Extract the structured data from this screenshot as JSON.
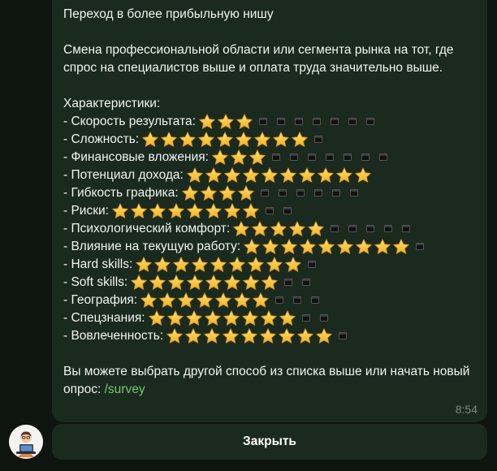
{
  "message": {
    "title": "Переход в более прибыльную нишу",
    "description": "Смена профессиональной области или сегмента рынка на тот, где спрос на специалистов выше и оплата труда значительно выше.",
    "characteristics_heading": "Характеристики:",
    "characteristics": [
      {
        "label": "- Скорость результата:",
        "stars": 3,
        "empty": 7
      },
      {
        "label": "- Сложность:",
        "stars": 9,
        "empty": 1
      },
      {
        "label": "- Финансовые вложения:",
        "stars": 3,
        "empty": 7
      },
      {
        "label": "- Потенциал дохода:",
        "stars": 10,
        "empty": 0
      },
      {
        "label": "- Гибкость графика:",
        "stars": 4,
        "empty": 6
      },
      {
        "label": "- Риски:",
        "stars": 8,
        "empty": 2
      },
      {
        "label": "- Психологический комфорт:",
        "stars": 5,
        "empty": 5
      },
      {
        "label": "- Влияние на текущую работу:",
        "stars": 9,
        "empty": 1
      },
      {
        "label": "- Hard skills:",
        "stars": 9,
        "empty": 1
      },
      {
        "label": "- Soft skills:",
        "stars": 8,
        "empty": 2
      },
      {
        "label": "- География:",
        "stars": 7,
        "empty": 3
      },
      {
        "label": "- Спецзнания:",
        "stars": 8,
        "empty": 2
      },
      {
        "label": "- Вовлеченность:",
        "stars": 9,
        "empty": 1
      }
    ],
    "footer_text": "Вы можете выбрать другой способ из списка выше или начать новый опрос: ",
    "survey_link": "/survey",
    "time": "8:54"
  },
  "keyboard": {
    "close_label": "Закрыть"
  },
  "icons": {
    "filled": "star-icon",
    "empty": "black-square-icon",
    "avatar": "bot-avatar"
  },
  "colors": {
    "background": "#0e1510",
    "bubble": "#1b2a1e",
    "link": "#72c96f",
    "star": "#f7c528"
  }
}
